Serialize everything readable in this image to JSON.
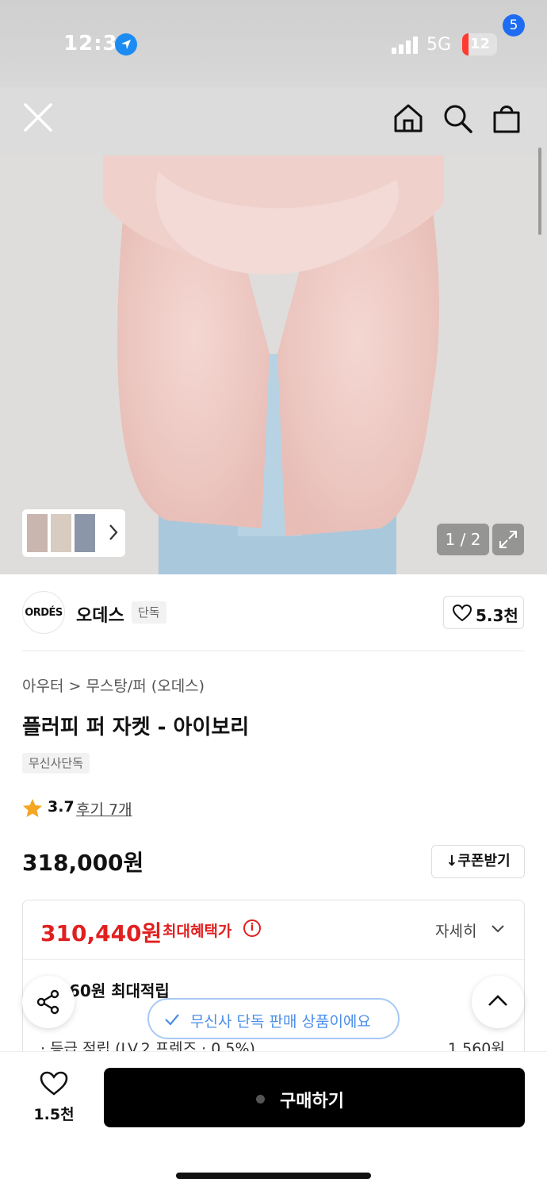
{
  "status_bar": {
    "time": "12:35",
    "network": "5G",
    "battery": "12"
  },
  "header": {
    "cart_count": "5"
  },
  "gallery": {
    "counter": "1 / 2"
  },
  "brand": {
    "logo_text": "ORDÉS",
    "name": "오데스",
    "tag": "단독",
    "like_count": "5.3천"
  },
  "product": {
    "breadcrumb": "아우터 > 무스탕/퍼 (오데스)",
    "title": "플러피 퍼 자켓 - 아이보리",
    "exclusive_tag": "무신사단독",
    "rating": "3.7",
    "review_link": "후기 7개",
    "price": "318,000원",
    "coupon_label": "쿠폰받기"
  },
  "benefit": {
    "sale_price": "310,440원",
    "max_benefit_label": "최대혜택가",
    "detail_label": "자세히",
    "points_total": "60원 최대적립",
    "grade_label": "· 등급 적립 (LV.2 프렌즈 · 0.5%)",
    "grade_value": "1,560원"
  },
  "overlay": {
    "exclusive_notice": "무신사 단독 판매 상품이에요"
  },
  "bottom_bar": {
    "wish_count": "1.5천",
    "buy_label": "구매하기"
  },
  "colors": {
    "accent_red": "#e02020",
    "badge_blue": "#1d6cf2",
    "pill_blue": "#4b8ee8"
  }
}
